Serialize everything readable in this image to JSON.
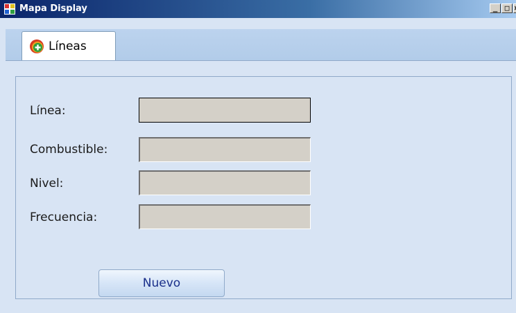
{
  "window": {
    "title": "Mapa Display",
    "controls": {
      "minimize": "_",
      "maximize": "□",
      "close": "×"
    }
  },
  "tabs": [
    {
      "label": "Líneas",
      "icon": "green-plus-icon",
      "selected": true
    }
  ],
  "form": {
    "fields": [
      {
        "label": "Línea:",
        "value": ""
      },
      {
        "label": "Combustible:",
        "value": ""
      },
      {
        "label": "Nivel:",
        "value": ""
      },
      {
        "label": "Frecuencia:",
        "value": ""
      }
    ],
    "button_label": "Nuevo"
  },
  "colors": {
    "window_bg": "#d8e4f4",
    "tabstrip_bg": "#b2cce9",
    "field_bg": "#d4d0c8",
    "button_text": "#1a2f8a"
  }
}
